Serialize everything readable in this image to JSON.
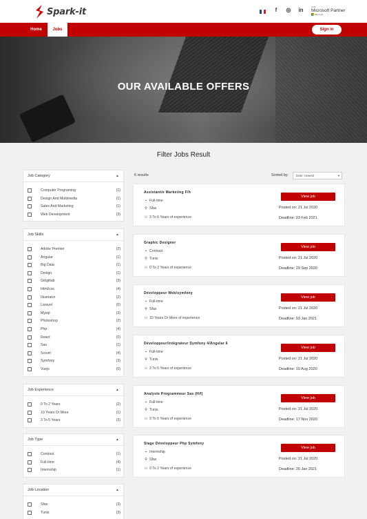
{
  "header": {
    "logo_text": "Spark-it",
    "partner_small": "Gold",
    "partner_big": "Microsoft Partner",
    "partner_tiny": "Microsoft",
    "nav": [
      "Home",
      "Jobs"
    ],
    "signin_label": "Sign in",
    "social": [
      "f",
      "◎",
      "in"
    ],
    "brand_color": "#c00000"
  },
  "hero": {
    "title": "OUR AVAILABLE OFFERS"
  },
  "section_title": "Filter Jobs Result",
  "filters": [
    {
      "title": "Job Category",
      "items": [
        {
          "label": "Computer Programing",
          "count": "(1)"
        },
        {
          "label": "Design And Multimedia",
          "count": "(1)"
        },
        {
          "label": "Sales And Marketing",
          "count": "(1)"
        },
        {
          "label": "Web Development",
          "count": "(3)"
        }
      ]
    },
    {
      "title": "Job Skills",
      "items": [
        {
          "label": "Adobe Premier",
          "count": "(2)"
        },
        {
          "label": "Angular",
          "count": "(1)"
        },
        {
          "label": "Big Data",
          "count": "(1)"
        },
        {
          "label": "Design",
          "count": "(1)"
        },
        {
          "label": "Git/gitlab",
          "count": "(3)"
        },
        {
          "label": "Html/css",
          "count": "(4)"
        },
        {
          "label": "Illustrator",
          "count": "(2)"
        },
        {
          "label": "Laravel",
          "count": "(0)"
        },
        {
          "label": "Mysql",
          "count": "(3)"
        },
        {
          "label": "Photoshop",
          "count": "(2)"
        },
        {
          "label": "Php",
          "count": "(4)"
        },
        {
          "label": "React",
          "count": "(0)"
        },
        {
          "label": "Sas",
          "count": "(1)"
        },
        {
          "label": "Scrum",
          "count": "(4)"
        },
        {
          "label": "Symfony",
          "count": "(3)"
        },
        {
          "label": "Vuejs",
          "count": "(0)"
        }
      ]
    },
    {
      "title": "Job Experience",
      "items": [
        {
          "label": "0 To 2 Years",
          "count": "(2)"
        },
        {
          "label": "10 Years Or More",
          "count": "(1)"
        },
        {
          "label": "3 To 5 Years",
          "count": "(3)"
        }
      ]
    },
    {
      "title": "Job Type",
      "items": [
        {
          "label": "Contract",
          "count": "(1)"
        },
        {
          "label": "Full-time",
          "count": "(4)"
        },
        {
          "label": "Internship",
          "count": "(1)"
        }
      ]
    },
    {
      "title": "Job Location",
      "items": [
        {
          "label": "Sfax",
          "count": "(3)"
        },
        {
          "label": "Tunis",
          "count": "(3)"
        }
      ]
    }
  ],
  "results": {
    "count_label": "6 results",
    "sorted_label": "Sorted by:",
    "sort_value": "Date: newest",
    "view_label": "View job",
    "jobs": [
      {
        "title": "Assistant/e Marketing F/h",
        "type": "Full-time",
        "location": "Sfax",
        "experience": "3 To 5 Years of experience",
        "posted": "Posted on: 21 Jul 2020",
        "deadline": "Deadline: 03 Feb 2021"
      },
      {
        "title": "Graphic Designer",
        "type": "Contract",
        "location": "Tunis",
        "experience": "0 To 2 Years of experience",
        "posted": "Posted on: 21 Jul 2020",
        "deadline": "Deadline: 29 Sep 2020"
      },
      {
        "title": "Développeur Web/symfony",
        "type": "Full-time",
        "location": "Sfax",
        "experience": "10 Years Or More of experience",
        "posted": "Posted on: 21 Jul 2020",
        "deadline": "Deadline: 03 Jan 2021"
      },
      {
        "title": "Développeur/intégrateur Symfony 4/Angular 6",
        "type": "Full-time",
        "location": "Tunis",
        "experience": "3 To 5 Years of experience",
        "posted": "Posted on: 21 Jul 2020",
        "deadline": "Deadline: 19 Aug 2020"
      },
      {
        "title": "Analyste Programmeur Sas (H/f)",
        "type": "Full-time",
        "location": "Tunis",
        "experience": "3 To 5 Years of experience",
        "posted": "Posted on: 21 Jul 2020",
        "deadline": "Deadline: 17 Nov 2020"
      },
      {
        "title": "Stage Développeur Php Symfony",
        "type": "Internship",
        "location": "Sfax",
        "experience": "0 To 2 Years of experience",
        "posted": "Posted on: 21 Jul 2020",
        "deadline": "Deadline: 26 Jan 2021"
      }
    ]
  }
}
